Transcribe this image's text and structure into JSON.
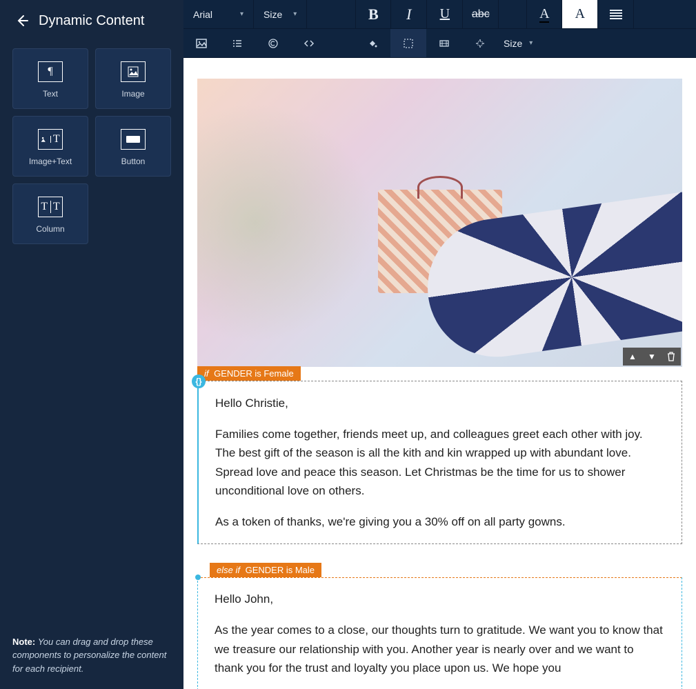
{
  "sidebar": {
    "title": "Dynamic Content",
    "components": {
      "text": "Text",
      "image": "Image",
      "imagetext": "Image+Text",
      "button": "Button",
      "column": "Column"
    },
    "note_label": "Note:",
    "note_text": "You can drag and drop these components to personalize the content for each recipient."
  },
  "toolbar": {
    "font": "Arial",
    "size_label": "Size",
    "bold": "B",
    "italic": "I",
    "underline": "U",
    "strike": "abc",
    "fontcolor": "A",
    "bgcolor": "A",
    "size2_label": "Size"
  },
  "email": {
    "if_condition": {
      "kw": "if",
      "text": "GENDER is Female"
    },
    "female": {
      "greeting": "Hello Christie,",
      "p1": "Families come together, friends meet up, and colleagues greet each other with joy. The best gift of the season is all the kith and kin wrapped up with abundant love. Spread love and peace this season. Let Christmas be the time for us to shower unconditional love on others.",
      "p2": "As a token of thanks, we're giving you a 30% off on all party gowns."
    },
    "elseif_condition": {
      "kw": "else if",
      "text": "GENDER is Male"
    },
    "male": {
      "greeting": "Hello John,",
      "p1": "As the year comes to a close, our thoughts turn to gratitude. We want you to know that we treasure our relationship with you. Another year is nearly over and we want to thank you for the trust and loyalty you place upon us. We hope you"
    }
  }
}
